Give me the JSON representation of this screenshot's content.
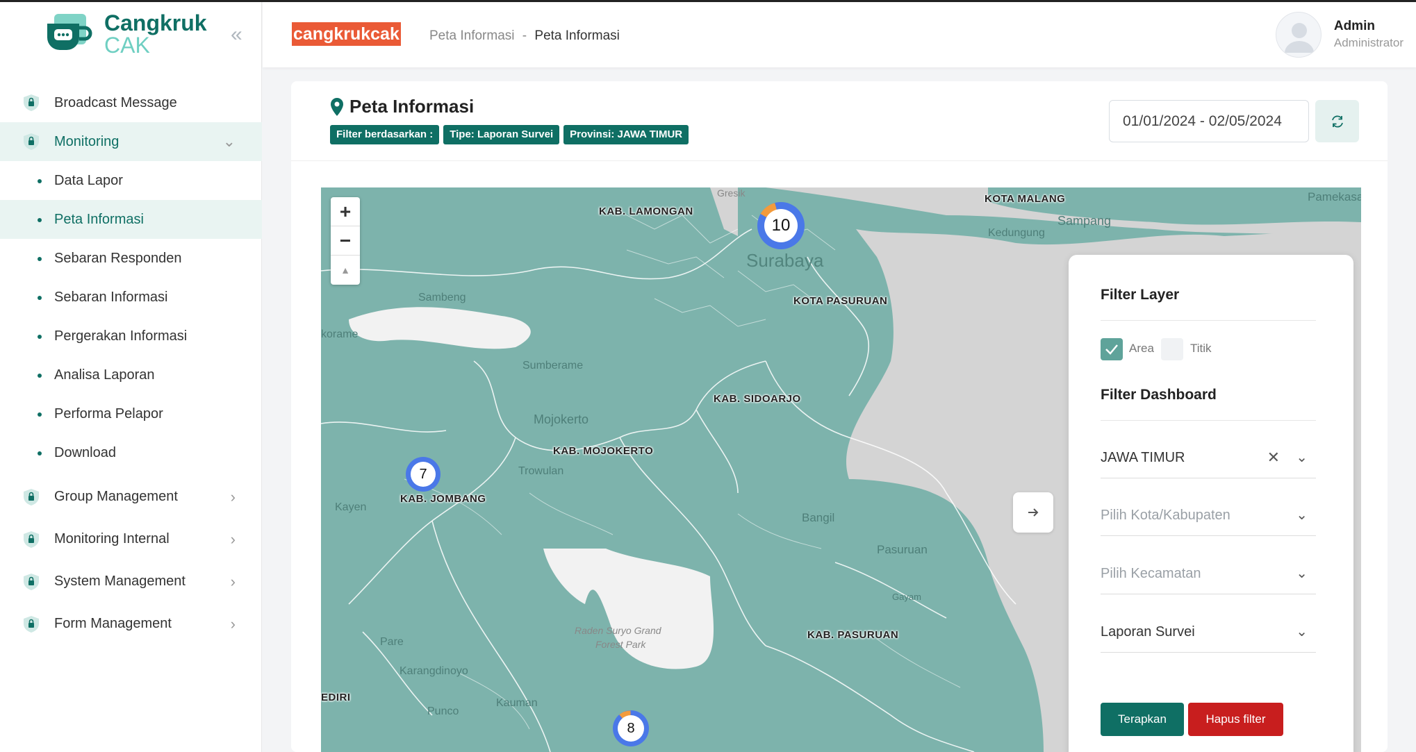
{
  "app": {
    "logo_line1": "Cangkruk",
    "logo_line2": "CAK",
    "brand": "cangkrukcak"
  },
  "breadcrumb": {
    "parent": "Peta Informasi",
    "separator": "-",
    "current": "Peta Informasi"
  },
  "user": {
    "name": "Admin",
    "role": "Administrator"
  },
  "sidebar": {
    "items": [
      {
        "label": "Broadcast Message"
      },
      {
        "label": "Monitoring"
      },
      {
        "label": "Group Management"
      },
      {
        "label": "Monitoring Internal"
      },
      {
        "label": "System Management"
      },
      {
        "label": "Form Management"
      }
    ],
    "monitoring_sub": [
      {
        "label": "Data Lapor"
      },
      {
        "label": "Peta Informasi"
      },
      {
        "label": "Sebaran Responden"
      },
      {
        "label": "Sebaran Informasi"
      },
      {
        "label": "Pergerakan Informasi"
      },
      {
        "label": "Analisa Laporan"
      },
      {
        "label": "Performa Pelapor"
      },
      {
        "label": "Download"
      }
    ]
  },
  "page": {
    "title": "Peta Informasi",
    "filter_badges": [
      "Filter berdasarkan :",
      "Tipe: Laporan Survei",
      "Provinsi: JAWA TIMUR"
    ],
    "date_range": "01/01/2024 - 02/05/2024"
  },
  "map": {
    "zoom_in": "+",
    "zoom_out": "−",
    "north": "▲",
    "region_labels": [
      "KAB. LAMONGAN",
      "KOTA MALANG",
      "KOTA PASURUAN",
      "KAB. SIDOARJO",
      "KAB. MOJOKERTO",
      "KAB. JOMBANG",
      "KAB. PASURUAN",
      "EDIRI"
    ],
    "places": [
      "Sambeng",
      "Kedungung",
      "Sampang",
      "Pamekasan",
      "korame",
      "Sumberame",
      "Mojokerto",
      "Trowulan",
      "Kayen",
      "Bangil",
      "Pasuruan",
      "Gayam",
      "Pare",
      "Karangdinoyo",
      "Kauman",
      "Punco",
      "Raden Suryo Grand",
      "Forest Park",
      "Gresik"
    ],
    "city": "Surabaya",
    "clusters": [
      {
        "count": "10"
      },
      {
        "count": "7"
      },
      {
        "count": "8"
      }
    ]
  },
  "filter_panel": {
    "layer_title": "Filter Layer",
    "layer_area": "Area",
    "layer_titik": "Titik",
    "area_checked": true,
    "titik_checked": false,
    "dashboard_title": "Filter Dashboard",
    "province_value": "JAWA TIMUR",
    "city_placeholder": "Pilih Kota/Kabupaten",
    "district_placeholder": "Pilih Kecamatan",
    "type_value": "Laporan Survei",
    "apply_label": "Terapkan",
    "clear_label": "Hapus filter"
  },
  "colors": {
    "primary": "#0f6f64",
    "brand": "#ea5a36",
    "danger": "#c81e1e",
    "map_land": "#7db3ac",
    "cluster": "#4a78e8"
  }
}
